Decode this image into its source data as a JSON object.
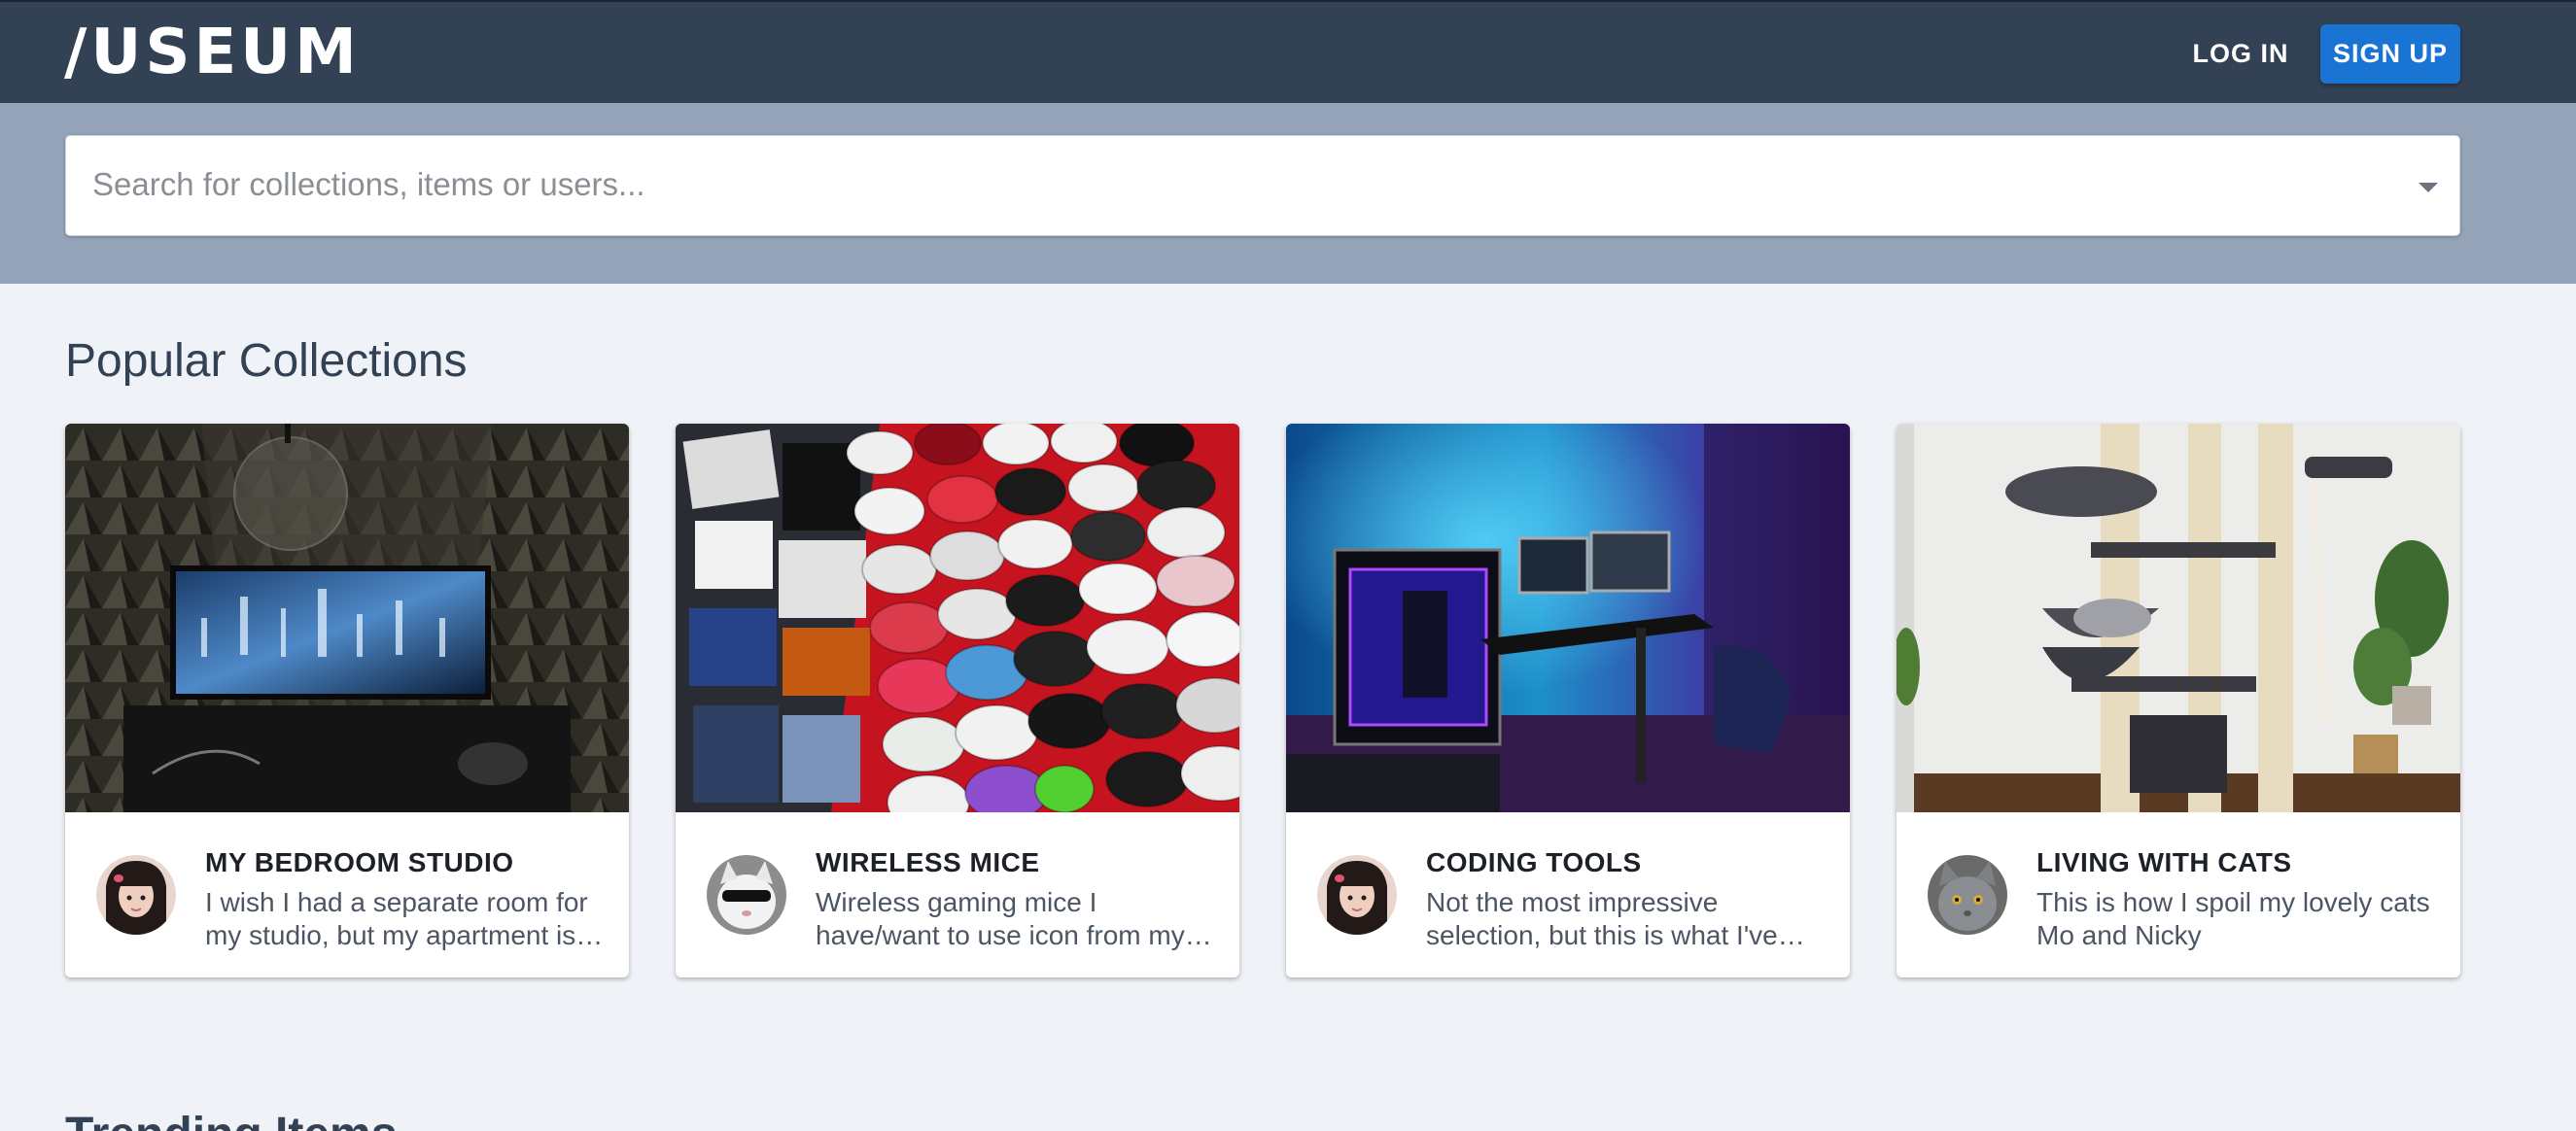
{
  "header": {
    "logo": "/USEUM",
    "login_label": "LOG IN",
    "signup_label": "SIGN UP"
  },
  "search": {
    "placeholder": "Search for collections, items or users...",
    "dropdown_icon": "caret-down-icon"
  },
  "popular": {
    "title": "Popular Collections",
    "cards": [
      {
        "title": "MY BEDROOM STUDIO",
        "description": "I wish I had a separate room for my studio, but my apartment is too small",
        "avatar": "avatar-woman"
      },
      {
        "title": "WIRELESS MICE",
        "description": "Wireless gaming mice I have/want to use icon from my collection",
        "avatar": "avatar-cat-sunglasses"
      },
      {
        "title": "CODING TOOLS",
        "description": "Not the most impressive selection, but this is what I've been using",
        "avatar": "avatar-woman"
      },
      {
        "title": "LIVING WITH CATS",
        "description": "This is how I spoil my lovely cats Mo and Nicky",
        "avatar": "avatar-grey-cat"
      }
    ]
  },
  "trending": {
    "title": "Trending Items"
  },
  "colors": {
    "navbar": "#334155",
    "search_band": "#94a3b8",
    "page_bg": "#eff2f7",
    "signup_accent": "#1a74d3"
  }
}
